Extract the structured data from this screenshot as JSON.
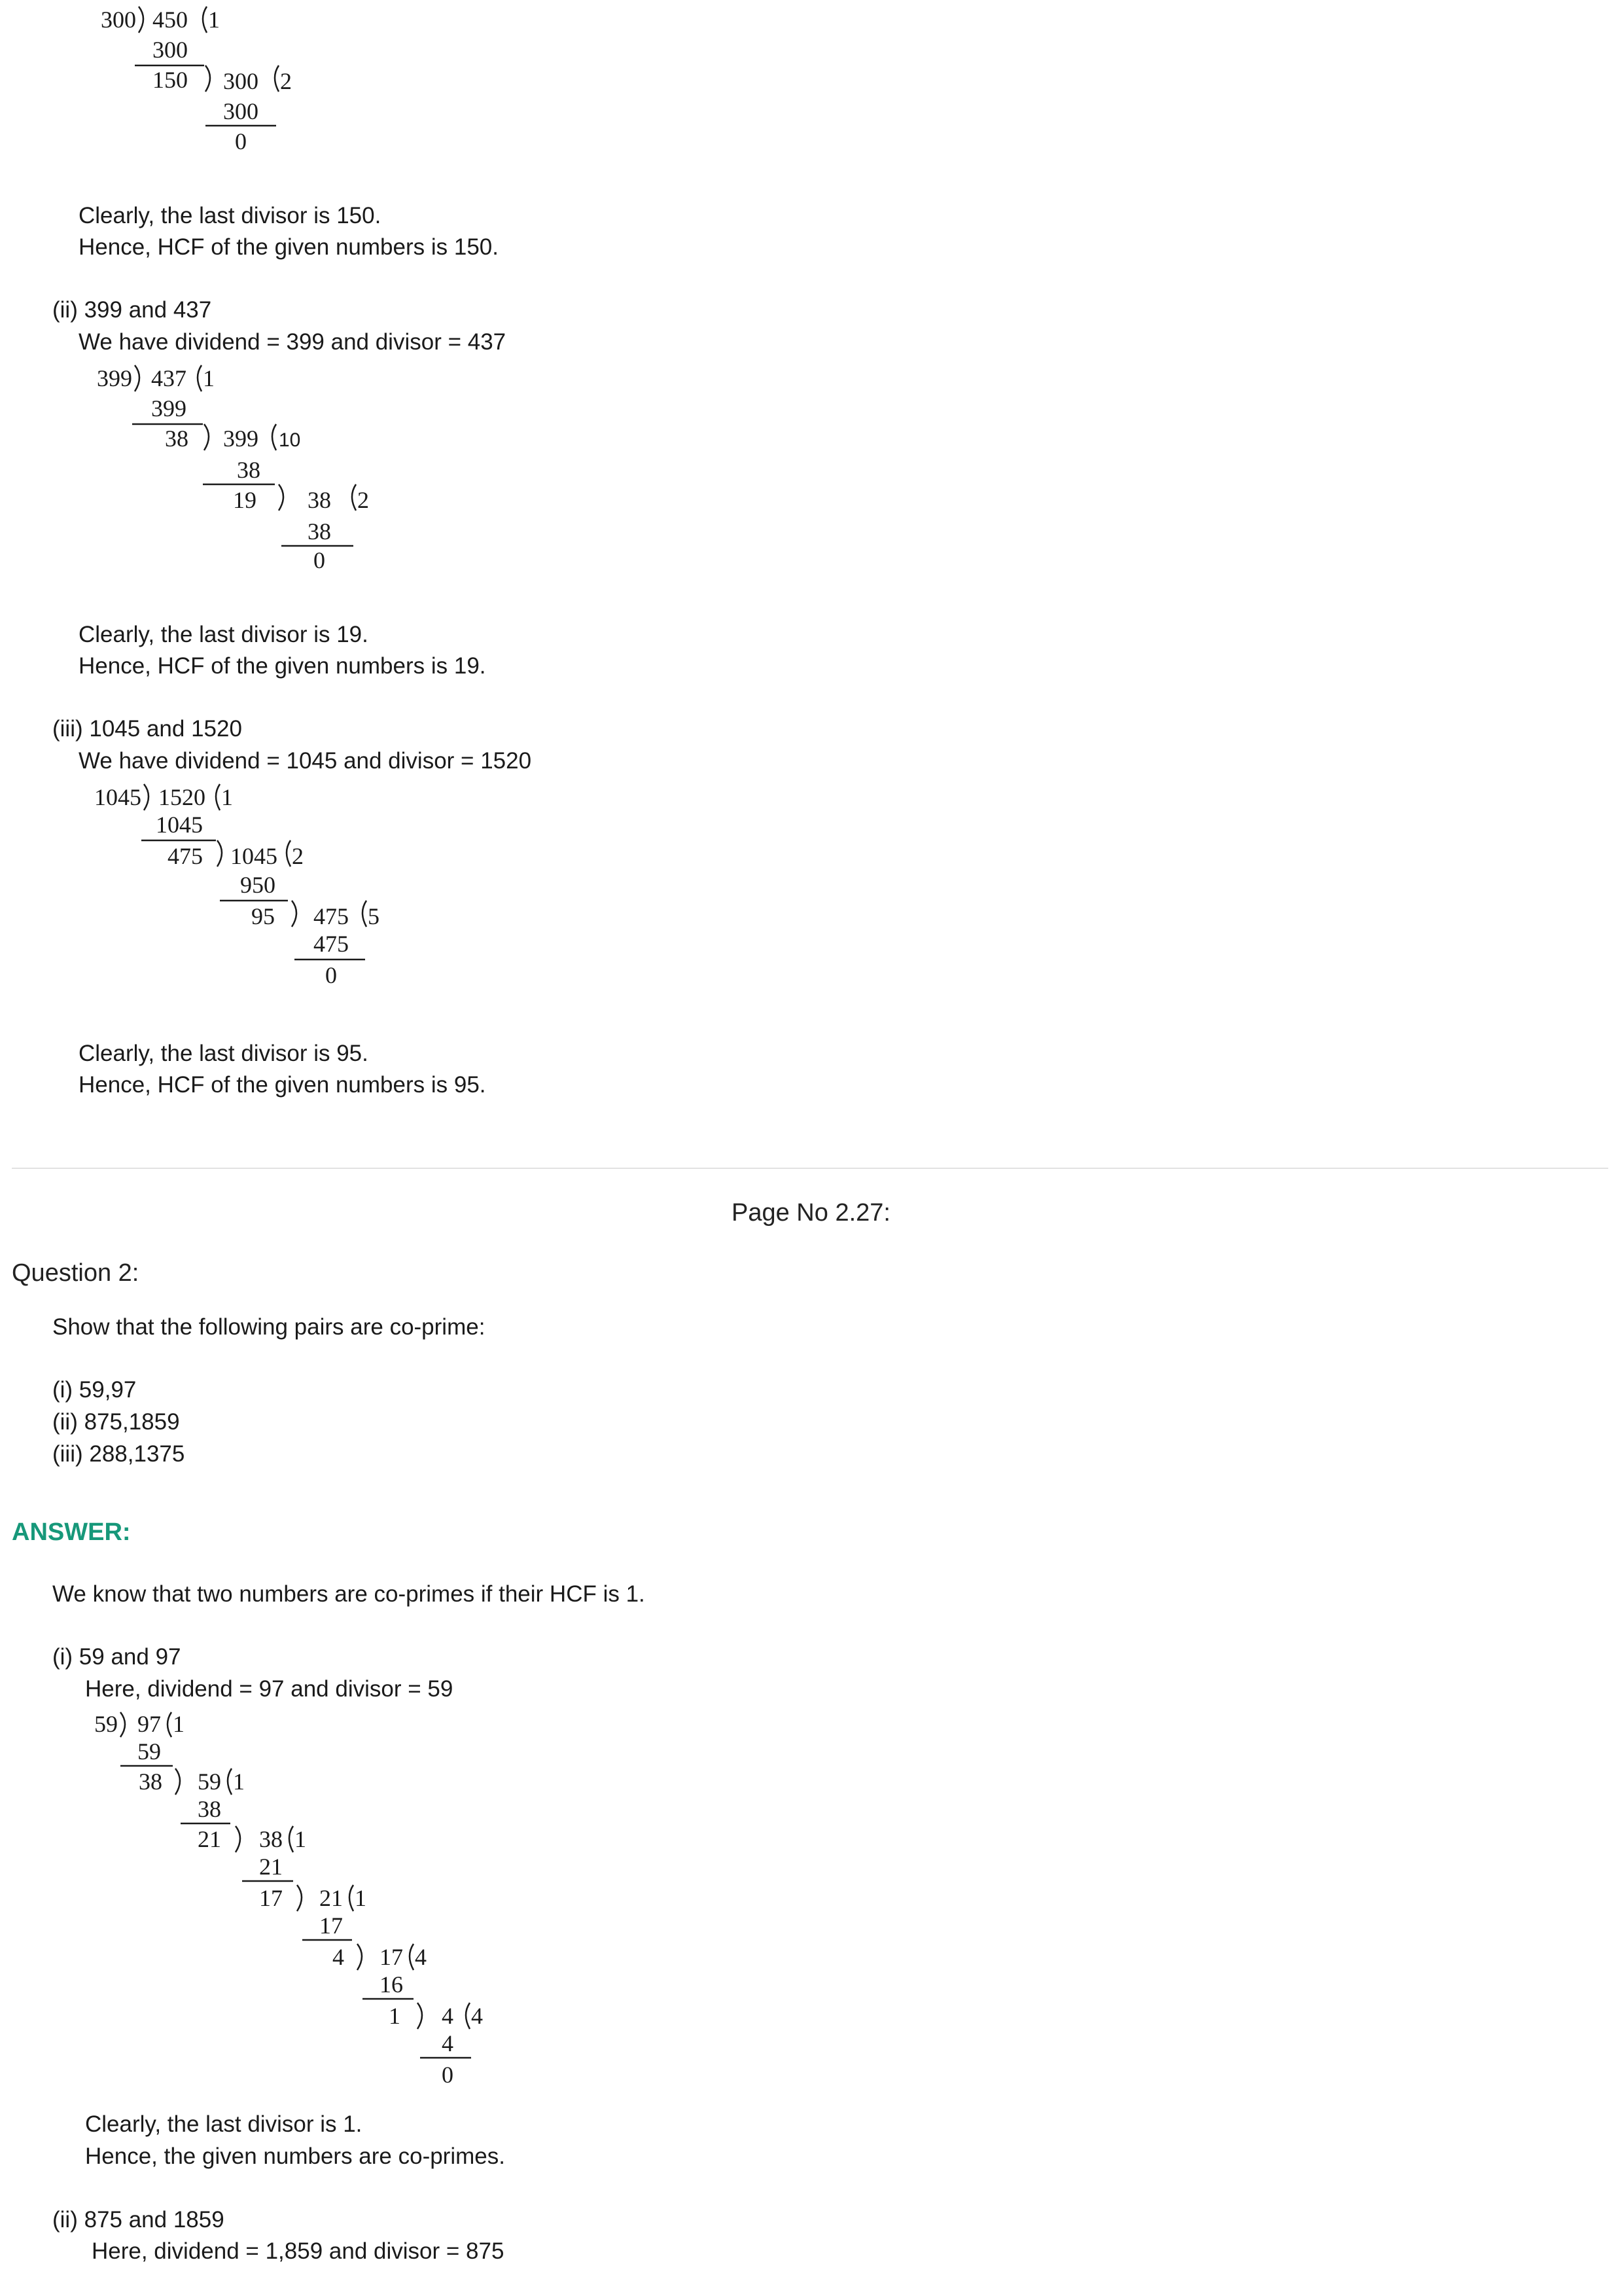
{
  "part1": {
    "division": [
      [
        "300",
        "450",
        "1",
        "300"
      ],
      [
        "150",
        "300",
        "2",
        "300"
      ],
      [
        "0"
      ]
    ],
    "line1": "Clearly, the last divisor is 150.",
    "line2": "Hence, HCF of the given numbers is 150."
  },
  "part2": {
    "heading": "(ii) 399 and 437",
    "setup": "We have dividend = 399 and divisor = 437",
    "division": [
      [
        "399",
        "437",
        "1",
        "399"
      ],
      [
        "38",
        "399",
        "10",
        "38"
      ],
      [
        "19",
        "38",
        "2",
        "38"
      ],
      [
        "0"
      ]
    ],
    "line1": "Clearly, the last divisor is 19.",
    "line2": "Hence, HCF of the given numbers is 19."
  },
  "part3": {
    "heading": "(iii) 1045 and 1520",
    "setup": "We have dividend = 1045 and divisor = 1520",
    "division": [
      [
        "1045",
        "1520",
        "1",
        "1045"
      ],
      [
        "475",
        "1045",
        "2",
        "950"
      ],
      [
        "95",
        "475",
        "5",
        "475"
      ],
      [
        "0"
      ]
    ],
    "line1": "Clearly, the last divisor is 95.",
    "line2": "Hence, HCF of the given numbers is 95."
  },
  "page_no": "Page No 2.27:",
  "question": {
    "title": "Question 2:",
    "prompt": "Show that the following pairs are co-prime:",
    "items": [
      "(i) 59,97",
      "(ii) 875,1859",
      "(iii) 288,1375"
    ]
  },
  "answer": {
    "label": "ANSWER:",
    "intro": "We know that two numbers are co-primes if their HCF is 1.",
    "sub1": {
      "heading": "(i) 59 and 97",
      "setup": "Here, dividend = 97 and divisor = 59",
      "division": [
        [
          "59",
          "97",
          "1",
          "59"
        ],
        [
          "38",
          "59",
          "1",
          "38"
        ],
        [
          "21",
          "38",
          "1",
          "21"
        ],
        [
          "17",
          "21",
          "1",
          "17"
        ],
        [
          "4",
          "17",
          "4",
          "16"
        ],
        [
          "1",
          "4",
          "4",
          "4"
        ],
        [
          "0"
        ]
      ],
      "line1": "Clearly, the last divisor is 1.",
      "line2": "Hence, the given numbers are co-primes."
    },
    "sub2": {
      "heading": "(ii) 875 and 1859",
      "setup": "Here, dividend = 1,859 and divisor = 875"
    }
  }
}
